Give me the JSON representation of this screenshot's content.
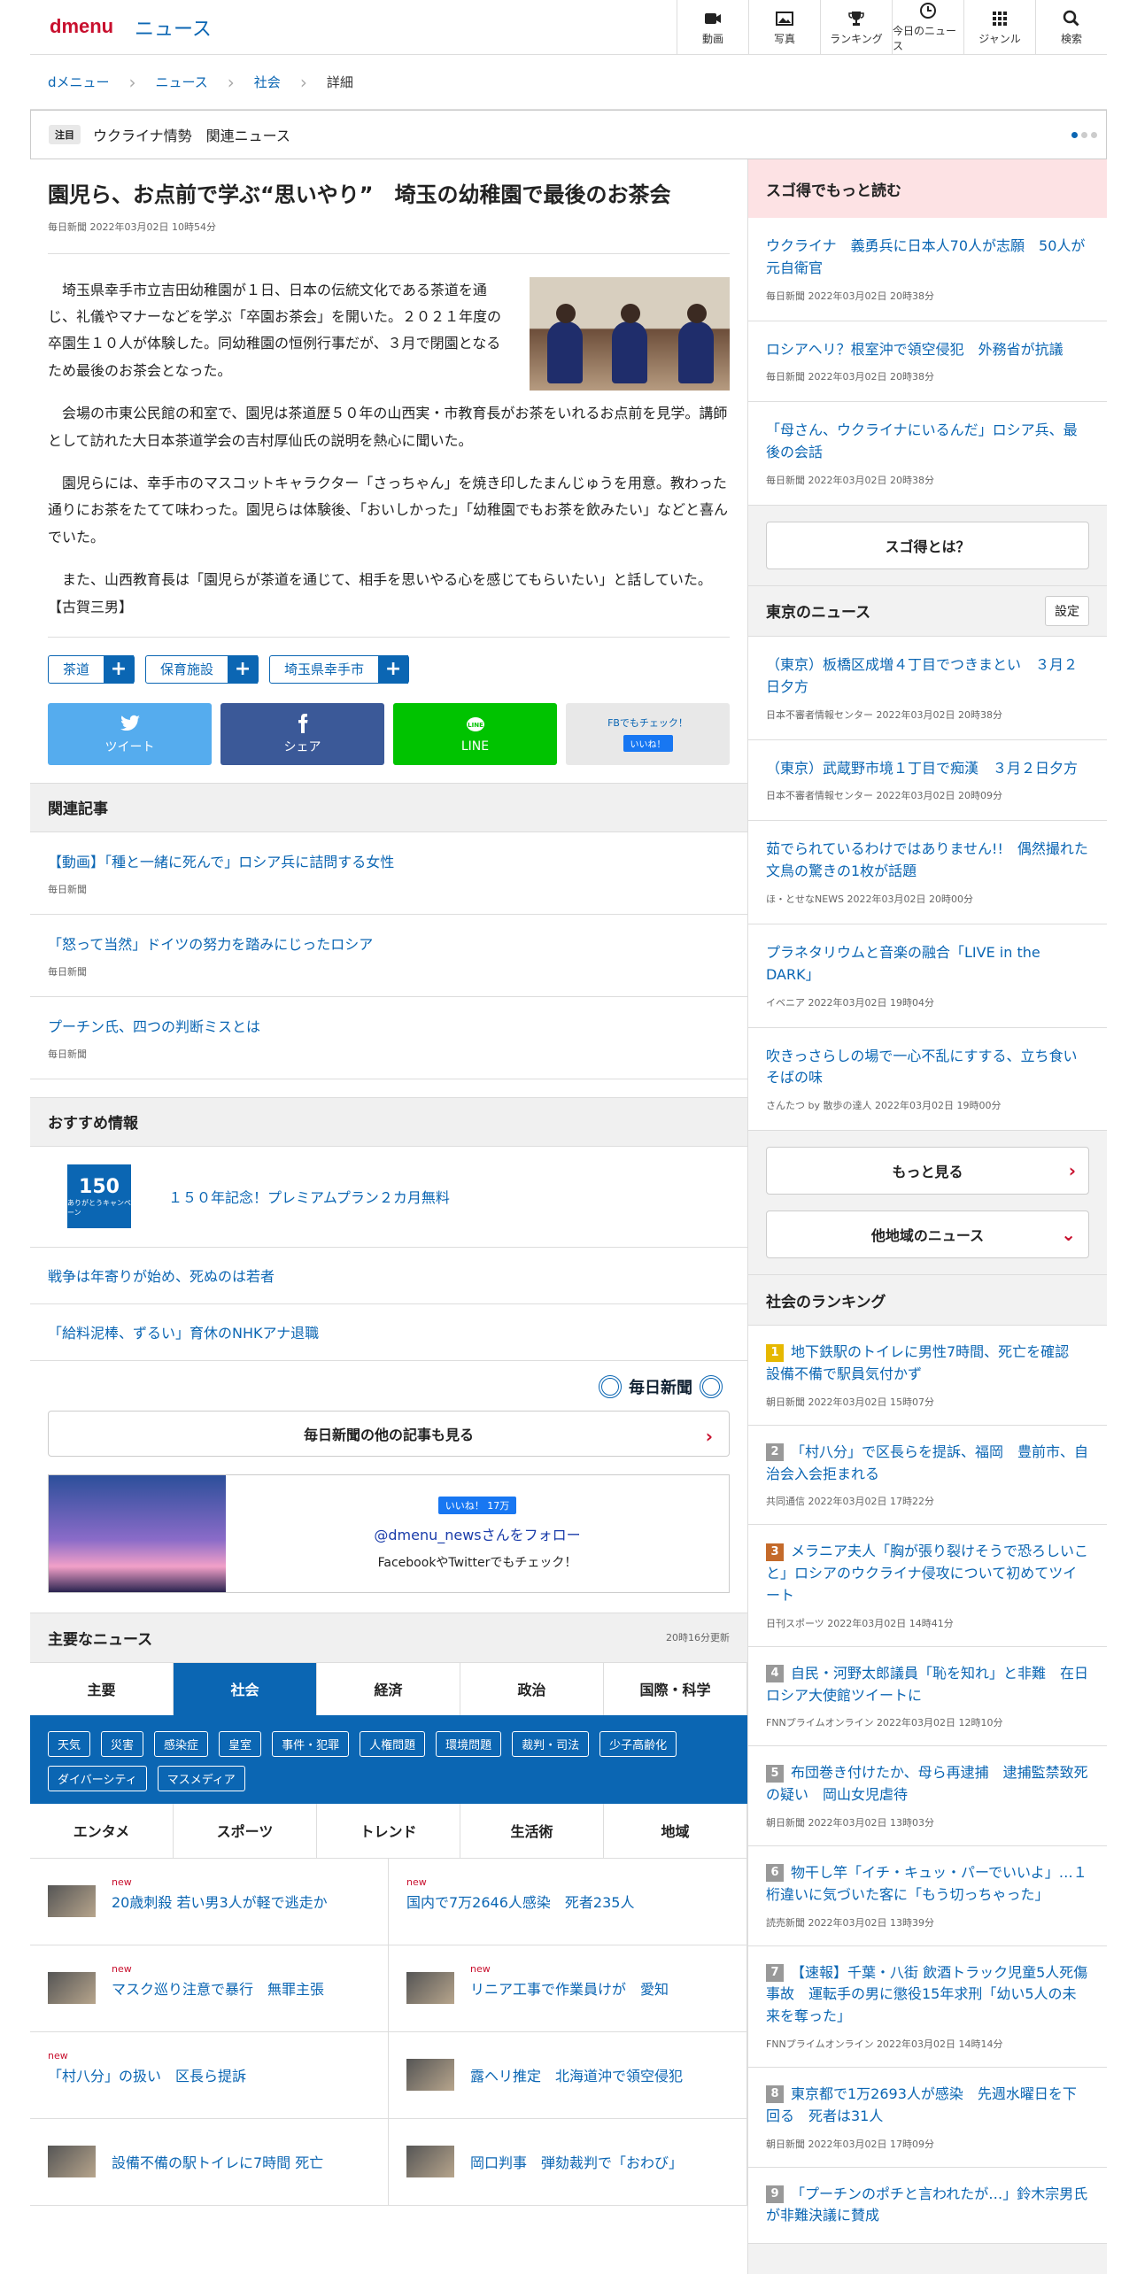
{
  "header": {
    "logo": "dmenu",
    "site": "ニュース",
    "nav": [
      {
        "label": "動画",
        "icon": "video-icon"
      },
      {
        "label": "写真",
        "icon": "photo-icon"
      },
      {
        "label": "ランキング",
        "icon": "trophy-icon"
      },
      {
        "label": "今日のニュース",
        "icon": "clock-icon"
      },
      {
        "label": "ジャンル",
        "icon": "grid-icon"
      },
      {
        "label": "検索",
        "icon": "search-icon"
      }
    ]
  },
  "breadcrumb": [
    "dメニュー",
    "ニュース",
    "社会",
    "詳細"
  ],
  "ticker": {
    "badge": "注目",
    "text": "ウクライナ情勢　関連ニュース"
  },
  "article": {
    "title": "園児ら、お点前で学ぶ“思いやり”　埼玉の幼稚園で最後のお茶会",
    "meta": "毎日新聞 2022年03月02日 10時54分",
    "paragraphs": [
      "埼玉県幸手市立吉田幼稚園が１日、日本の伝統文化である茶道を通じ、礼儀やマナーなどを学ぶ「卒園お茶会」を開いた。２０２１年度の卒園生１０人が体験した。同幼稚園の恒例行事だが、３月で閉園となるため最後のお茶会となった。",
      "会場の市東公民館の和室で、園児は茶道歴５０年の山西実・市教育長がお茶をいれるお点前を見学。講師として訪れた大日本茶道学会の吉村厚仙氏の説明を熱心に聞いた。",
      "園児らには、幸手市のマスコットキャラクター「さっちゃん」を焼き印したまんじゅうを用意。教わった通りにお茶をたてて味わった。園児らは体験後、「おいしかった」「幼稚園でもお茶を飲みたい」などと喜んでいた。",
      "また、山西教育長は「園児らが茶道を通じて、相手を思いやる心を感じてもらいたい」と話していた。【古賀三男】"
    ],
    "tags": [
      "茶道",
      "保育施設",
      "埼玉県幸手市"
    ],
    "share": {
      "tweet": "ツイート",
      "share": "シェア",
      "line": "LINE",
      "fbcheck": "FBでもチェック！",
      "like": "いいね！"
    }
  },
  "related": {
    "title": "関連記事",
    "items": [
      {
        "title": "【動画】「種と一緒に死んで」ロシア兵に詰問する女性",
        "source": "毎日新聞"
      },
      {
        "title": "「怒って当然」ドイツの努力を踏みにじったロシア",
        "source": "毎日新聞"
      },
      {
        "title": "プーチン氏、四つの判断ミスとは",
        "source": "毎日新聞"
      }
    ]
  },
  "recommend": {
    "title": "おすすめ情報",
    "promo": "１５０年記念！プレミアムプラン２カ月無料",
    "promo_icon_num": "150",
    "promo_icon_sub": "ありがとうキャンペーン",
    "items": [
      "戦争は年寄りが始め、死ぬのは若者",
      "「給料泥棒、ずるい」育休のNHKアナ退職"
    ]
  },
  "mainichi": {
    "logo": "毎日新聞",
    "more": "毎日新聞の他の記事も見る",
    "follow": "@dmenu_newsさんをフォロー",
    "follow_sub": "FacebookやTwitterでもチェック！",
    "likes": "いいね！ 17万"
  },
  "main_news": {
    "title": "主要なニュース",
    "updated": "20時16分更新",
    "tabs": [
      "主要",
      "社会",
      "経済",
      "政治",
      "国際・科学"
    ],
    "subtags": [
      "天気",
      "災害",
      "感染症",
      "皇室",
      "事件・犯罪",
      "人権問題",
      "環境問題",
      "裁判・司法",
      "少子高齢化",
      "ダイバーシティ",
      "マスメディア"
    ],
    "tabs2": [
      "エンタメ",
      "スポーツ",
      "トレンド",
      "生活術",
      "地域"
    ],
    "items": [
      {
        "title": "20歳刺殺 若い男3人が軽で逃走か",
        "new": "new"
      },
      {
        "title": "国内で7万2646人感染　死者235人",
        "new": "new"
      },
      {
        "title": "マスク巡り注意で暴行　無罪主張",
        "new": "new"
      },
      {
        "title": "リニア工事で作業員けが　愛知",
        "new": "new"
      },
      {
        "title": "「村八分」の扱い　区長ら提訴",
        "new": "new"
      },
      {
        "title": "露ヘリ推定　北海道沖で領空侵犯",
        "new": ""
      },
      {
        "title": "設備不備の駅トイレに7時間 死亡",
        "new": ""
      },
      {
        "title": "岡口判事　弾劾裁判で「おわび」",
        "new": ""
      }
    ]
  },
  "right": {
    "sugo_title": "スゴ得でもっと読む",
    "sugo": [
      {
        "title": "ウクライナ　義勇兵に日本人70人が志願　50人が元自衛官",
        "src": "毎日新聞 2022年03月02日 20時38分"
      },
      {
        "title": "ロシアヘリ？根室沖で領空侵犯　外務省が抗議",
        "src": "毎日新聞 2022年03月02日 20時38分"
      },
      {
        "title": "「母さん、ウクライナにいるんだ」ロシア兵、最後の会話",
        "src": "毎日新聞 2022年03月02日 20時38分"
      }
    ],
    "sugo_btn": "スゴ得とは？",
    "tokyo_title": "東京のニュース",
    "tokyo_set": "設定",
    "tokyo": [
      {
        "title": "（東京）板橋区成増４丁目でつきまとい　３月２日夕方",
        "src": "日本不審者情報センター 2022年03月02日 20時38分"
      },
      {
        "title": "（東京）武蔵野市境１丁目で痴漢　３月２日夕方",
        "src": "日本不審者情報センター 2022年03月02日 20時09分"
      },
      {
        "title": "茹でられているわけではありません!!　偶然撮れた文鳥の驚きの1枚が話題",
        "src": "ほ・とせなNEWS 2022年03月02日 20時00分"
      },
      {
        "title": "プラネタリウムと音楽の融合「LIVE in the DARK」",
        "src": "イベニア 2022年03月02日 19時04分"
      },
      {
        "title": "吹きっさらしの場で一心不乱にすする、立ち食いそばの味",
        "src": "さんたつ by 散歩の達人 2022年03月02日 19時00分"
      }
    ],
    "more": "もっと見る",
    "other": "他地域のニュース",
    "rank_title": "社会のランキング",
    "ranking": [
      {
        "n": "1",
        "title": "地下鉄駅のトイレに男性7時間、死亡を確認　設備不備で駅員気付かず",
        "src": "朝日新聞 2022年03月02日 15時07分"
      },
      {
        "n": "2",
        "title": "「村八分」で区長らを提訴、福岡　豊前市、自治会入会拒まれる",
        "src": "共同通信 2022年03月02日 17時22分"
      },
      {
        "n": "3",
        "title": "メラニア夫人「胸が張り裂けそうで恐ろしいこと」ロシアのウクライナ侵攻について初めてツイート",
        "src": "日刊スポーツ 2022年03月02日 14時41分"
      },
      {
        "n": "4",
        "title": "自民・河野太郎議員「恥を知れ」と非難　在日ロシア大使館ツイートに",
        "src": "FNNプライムオンライン 2022年03月02日 12時10分"
      },
      {
        "n": "5",
        "title": "布団巻き付けたか、母ら再逮捕　逮捕監禁致死の疑い　岡山女児虐待",
        "src": "朝日新聞 2022年03月02日 13時03分"
      },
      {
        "n": "6",
        "title": "物干し竿「イチ・キュッ・パーでいいよ」…１桁違いに気づいた客に「もう切っちゃった」",
        "src": "読売新聞 2022年03月02日 13時39分"
      },
      {
        "n": "7",
        "title": "【速報】千葉・八街 飲酒トラック児童5人死傷事故　運転手の男に懲役15年求刑「幼い5人の未来を奪った」",
        "src": "FNNプライムオンライン 2022年03月02日 14時14分"
      },
      {
        "n": "8",
        "title": "東京都で1万2693人が感染　先週水曜日を下回る　死者は31人",
        "src": "朝日新聞 2022年03月02日 17時09分"
      },
      {
        "n": "9",
        "title": "「プーチンのポチと言われたが…」鈴木宗男氏が非難決議に賛成",
        "src": ""
      }
    ]
  }
}
